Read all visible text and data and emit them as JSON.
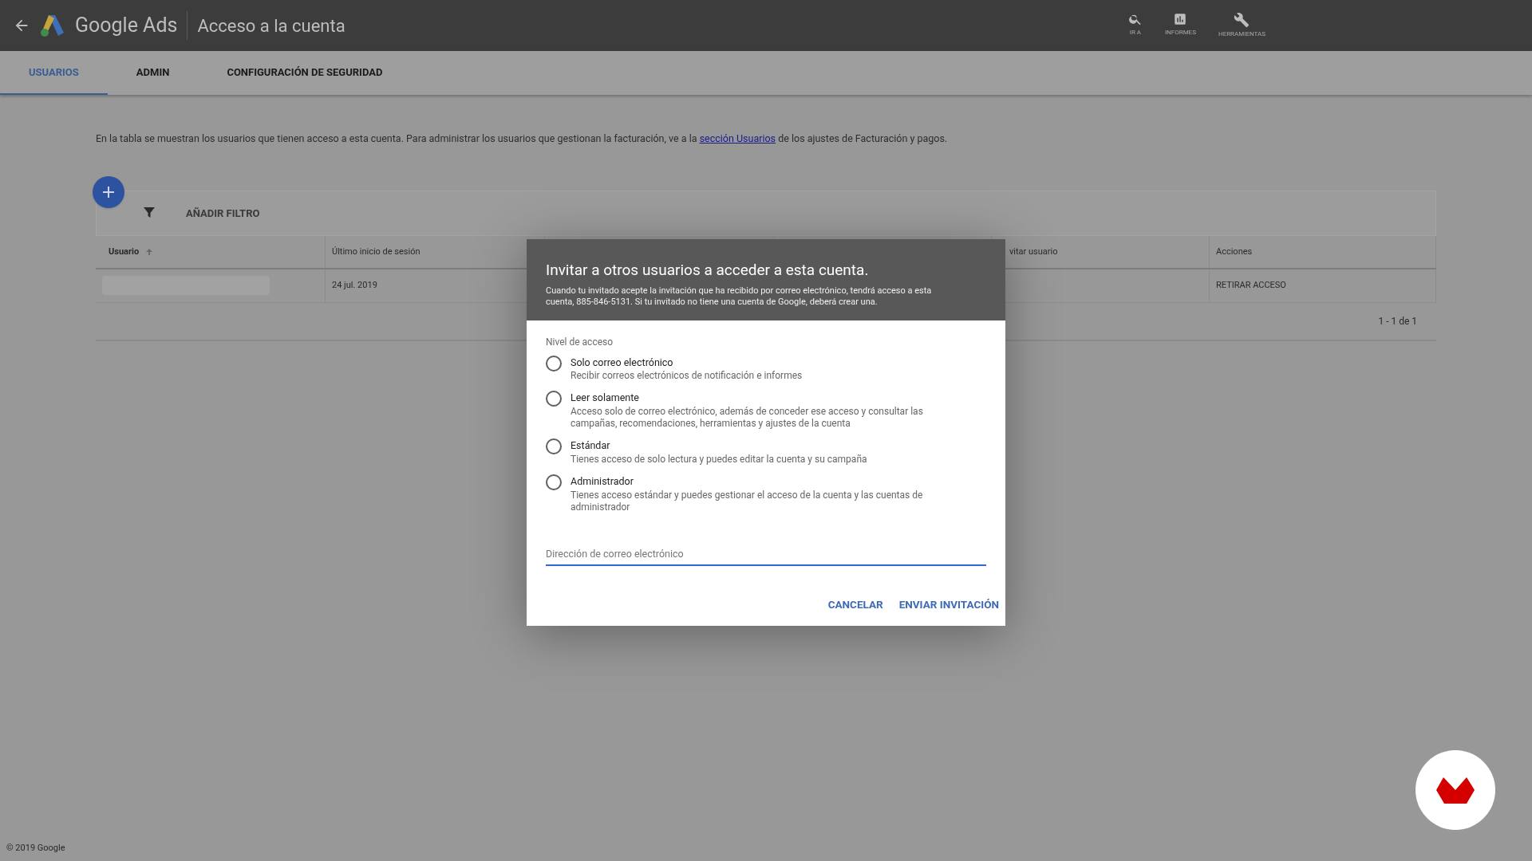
{
  "header": {
    "product": "Google Ads",
    "title": "Acceso a la cuenta",
    "tools": [
      {
        "kind": "search",
        "label": "IR A"
      },
      {
        "kind": "reports",
        "label": "INFORMES"
      },
      {
        "kind": "tools",
        "label": "HERRAMIENTAS"
      }
    ]
  },
  "tabs": [
    {
      "label": "USUARIOS",
      "selected": true
    },
    {
      "label": "ADMIN",
      "selected": false
    },
    {
      "label": "CONFIGURACIÓN DE SEGURIDAD",
      "selected": false
    }
  ],
  "intro": {
    "before": "En la tabla se muestran los usuarios que tienen acceso a esta cuenta. Para administrar los usuarios que gestionan la facturación, ve a la",
    "link": "sección Usuarios",
    "after": "de los ajustes de Facturación y pagos."
  },
  "add_filter": "AÑADIR FILTRO",
  "table": {
    "columns": [
      "Usuario",
      "Último inicio de sesión",
      "",
      "",
      "vitar usuario",
      "Acciones"
    ],
    "rows": [
      [
        "",
        "24 jul. 2019",
        "",
        "",
        "",
        "RETIRAR ACCESO"
      ]
    ],
    "pagination": "1 - 1 de 1"
  },
  "dialog": {
    "title": "Invitar a otros usuarios a acceder a esta cuenta.",
    "subtitle": "Cuando tu invitado acepte la invitación que ha recibido por correo electrónico, tendrá acceso a esta cuenta, 885-846-5131. Si tu invitado no tiene una cuenta de Google, deberá crear una.",
    "group_label": "Nivel de acceso",
    "options": [
      {
        "label": "Solo correo electrónico",
        "description": "Recibir correos electrónicos de notificación e informes",
        "selected": false
      },
      {
        "label": "Leer solamente",
        "description": "Acceso solo de correo electrónico, además de conceder ese acceso y consultar las campañas, recomendaciones, herramientas y ajustes de la cuenta",
        "selected": false
      },
      {
        "label": "Estándar",
        "description": "Tienes acceso de solo lectura y puedes editar la cuenta y su campaña",
        "selected": false
      },
      {
        "label": "Administrador",
        "description": "Tienes acceso estándar y puedes gestionar el acceso de la cuenta y las cuentas de administrador",
        "selected": false
      }
    ],
    "email": {
      "placeholder": "Dirección de correo electrónico"
    },
    "buttons": [
      "CANCELAR",
      "ENVIAR INVITACIÓN"
    ]
  },
  "footer": "© 2019 Google"
}
